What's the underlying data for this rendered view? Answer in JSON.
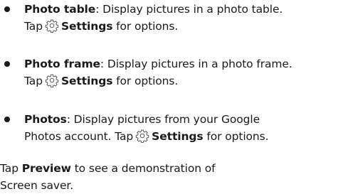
{
  "items": [
    {
      "title": "Photo table",
      "desc": ": Display pictures in a photo table.",
      "tap": "Tap",
      "settings": "Settings",
      "for_options": "for options.",
      "icon": "settings-gear-icon"
    },
    {
      "title": "Photo frame",
      "desc": ": Display pictures in a photo frame.",
      "tap": "Tap",
      "settings": "Settings",
      "for_options": "for options.",
      "icon": "settings-gear-icon"
    },
    {
      "title": "Photos",
      "desc": ": Display pictures from your Google",
      "desc2": "Photos account. Tap",
      "settings": "Settings",
      "for_options": "for options.",
      "icon": "settings-gear-icon"
    }
  ],
  "closing": {
    "tap": "Tap",
    "preview": "Preview",
    "rest1": "to see a demonstration of",
    "rest2": "Screen saver."
  }
}
